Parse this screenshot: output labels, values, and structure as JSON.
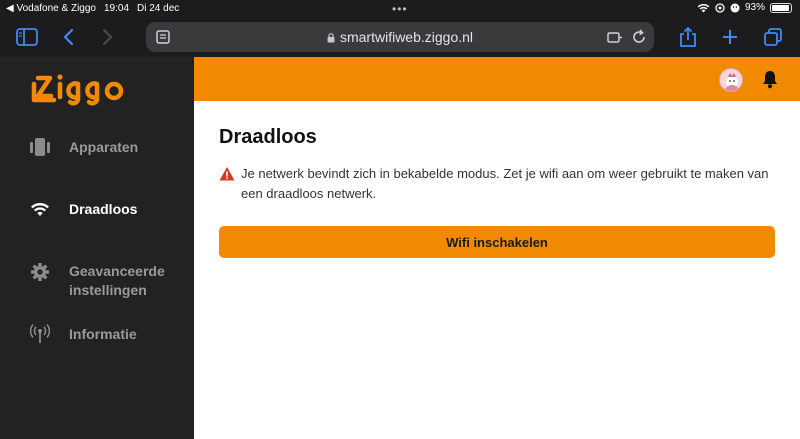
{
  "status_bar": {
    "back_label": "◀ Vodafone & Ziggo",
    "time": "19:04",
    "date": "Di 24 dec",
    "dots": "•••",
    "battery": "93%",
    "battery_level": 0.93
  },
  "browser": {
    "url": "smartwifiweb.ziggo.nl",
    "icons": [
      "sidebar-icon",
      "back-icon",
      "forward-icon",
      "reader-icon",
      "lock-icon",
      "extension-icon",
      "reload-icon",
      "share-icon",
      "new-tab-icon",
      "tabs-icon"
    ]
  },
  "brand": {
    "accent": "#f18a00",
    "sidebar_bg": "#222222"
  },
  "sidebar": {
    "items": [
      {
        "label": "Apparaten",
        "icon": "devices-icon",
        "active": false
      },
      {
        "label": "Draadloos",
        "icon": "wifi-icon",
        "active": true
      },
      {
        "label_line1": "Geavanceerde",
        "label_line2": "instellingen",
        "icon": "gear-icon",
        "active": false
      },
      {
        "label": "Informatie",
        "icon": "antenna-icon",
        "active": false
      }
    ]
  },
  "header": {
    "avatar": "user-avatar",
    "bell": "bell-icon"
  },
  "main": {
    "title": "Draadloos",
    "warning_icon": "warning-icon",
    "notice": "Je netwerk bevindt zich in bekabelde modus. Zet je wifi aan om weer gebruikt te maken van een draadloos netwerk.",
    "button_label": "Wifi inschakelen"
  }
}
